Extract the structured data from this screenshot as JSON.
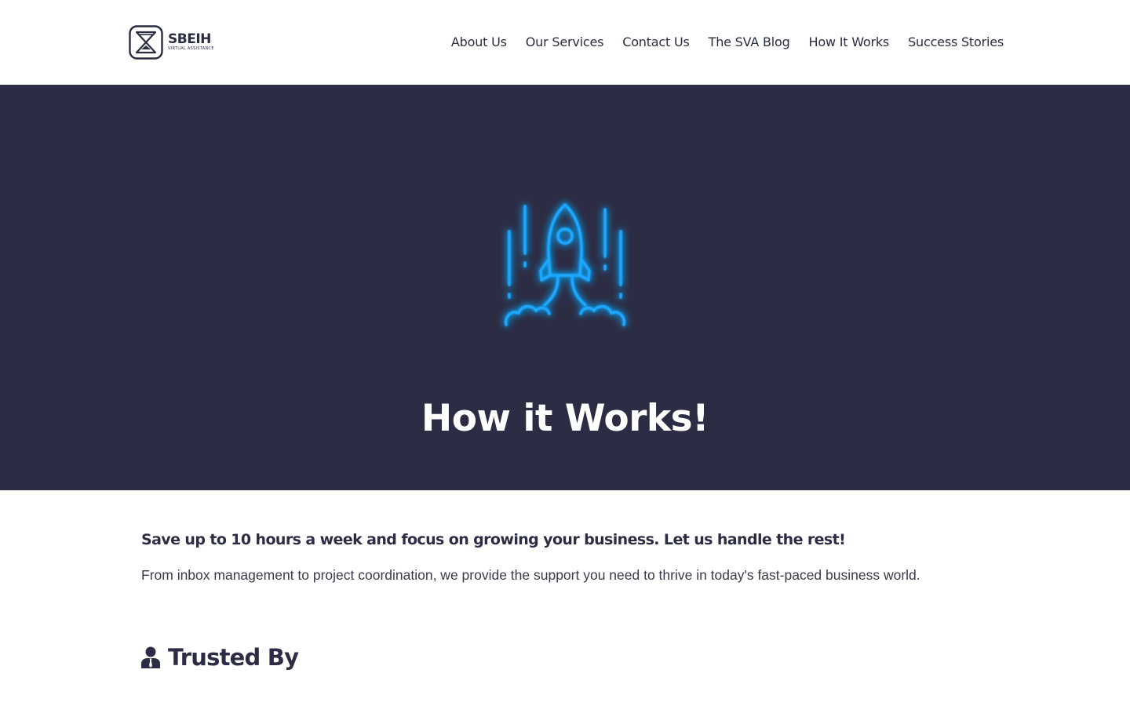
{
  "brand": {
    "name": "SBEIH",
    "tagline": "VIRTUAL ASSISTANCE"
  },
  "nav": {
    "items": [
      {
        "label": "About Us"
      },
      {
        "label": "Our Services"
      },
      {
        "label": "Contact Us"
      },
      {
        "label": "The SVA Blog"
      },
      {
        "label": "How It Works"
      },
      {
        "label": "Success Stories"
      }
    ]
  },
  "hero": {
    "icon": "rocket-launch-icon",
    "title": "How it Works!",
    "background_color": "#2c2d44",
    "glow_color": "#1ea8ff"
  },
  "intro": {
    "heading": "Save up to 10 hours a week and focus on growing your business. Let us handle the rest!",
    "text": "From inbox management to project coordination, we provide the support you need to thrive in today's fast-paced business world."
  },
  "trusted": {
    "icon": "user-tie-icon",
    "title": "Trusted By"
  }
}
